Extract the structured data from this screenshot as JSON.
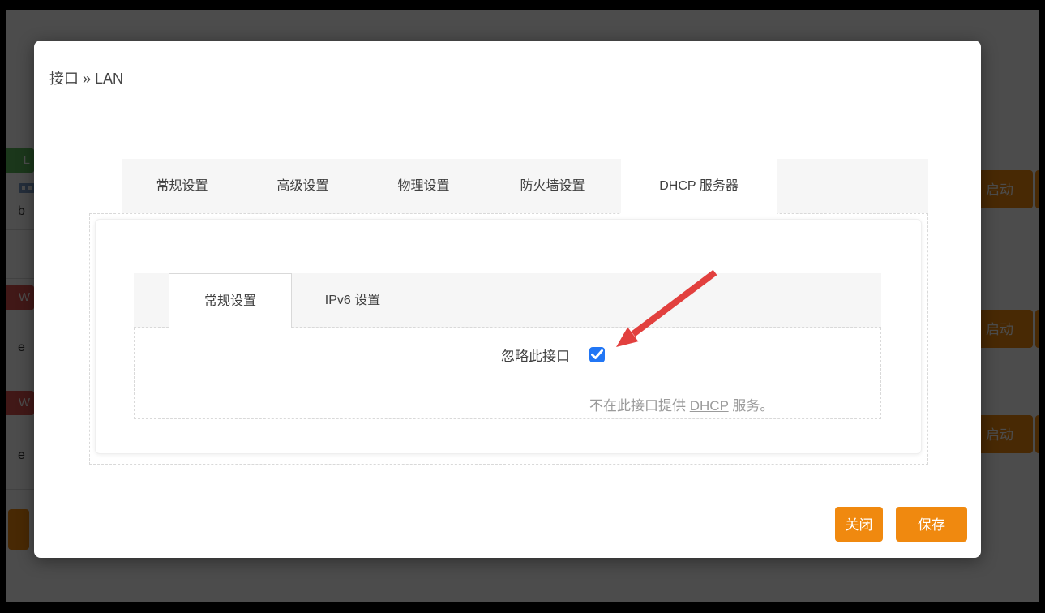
{
  "background": {
    "interfaces": [
      {
        "badge": "L",
        "badge_color": "#5cb85c",
        "device_partial": "b"
      },
      {
        "badge": "W",
        "badge_color": "#d9534f",
        "device_partial": "e"
      },
      {
        "badge": "W",
        "badge_color": "#d9534f",
        "device_partial": "e"
      }
    ],
    "start_button_label": "启动",
    "button_color": "#f0890f"
  },
  "modal": {
    "title": "接口 » LAN",
    "tabs": [
      {
        "label": "常规设置"
      },
      {
        "label": "高级设置"
      },
      {
        "label": "物理设置"
      },
      {
        "label": "防火墙设置"
      },
      {
        "label": "DHCP 服务器"
      }
    ],
    "active_tab": "DHCP 服务器",
    "subtabs": [
      {
        "label": "常规设置"
      },
      {
        "label": "IPv6 设置"
      }
    ],
    "active_subtab": "常规设置",
    "field": {
      "label": "忽略此接口",
      "checkbox_checked": true,
      "checkbox_color": "#2176f5",
      "description_prefix": "不在此接口提供 ",
      "description_link": "DHCP",
      "description_suffix": " 服务。"
    },
    "footer": {
      "close_label": "关闭",
      "save_label": "保存"
    },
    "arrow_color": "#e2403e"
  }
}
